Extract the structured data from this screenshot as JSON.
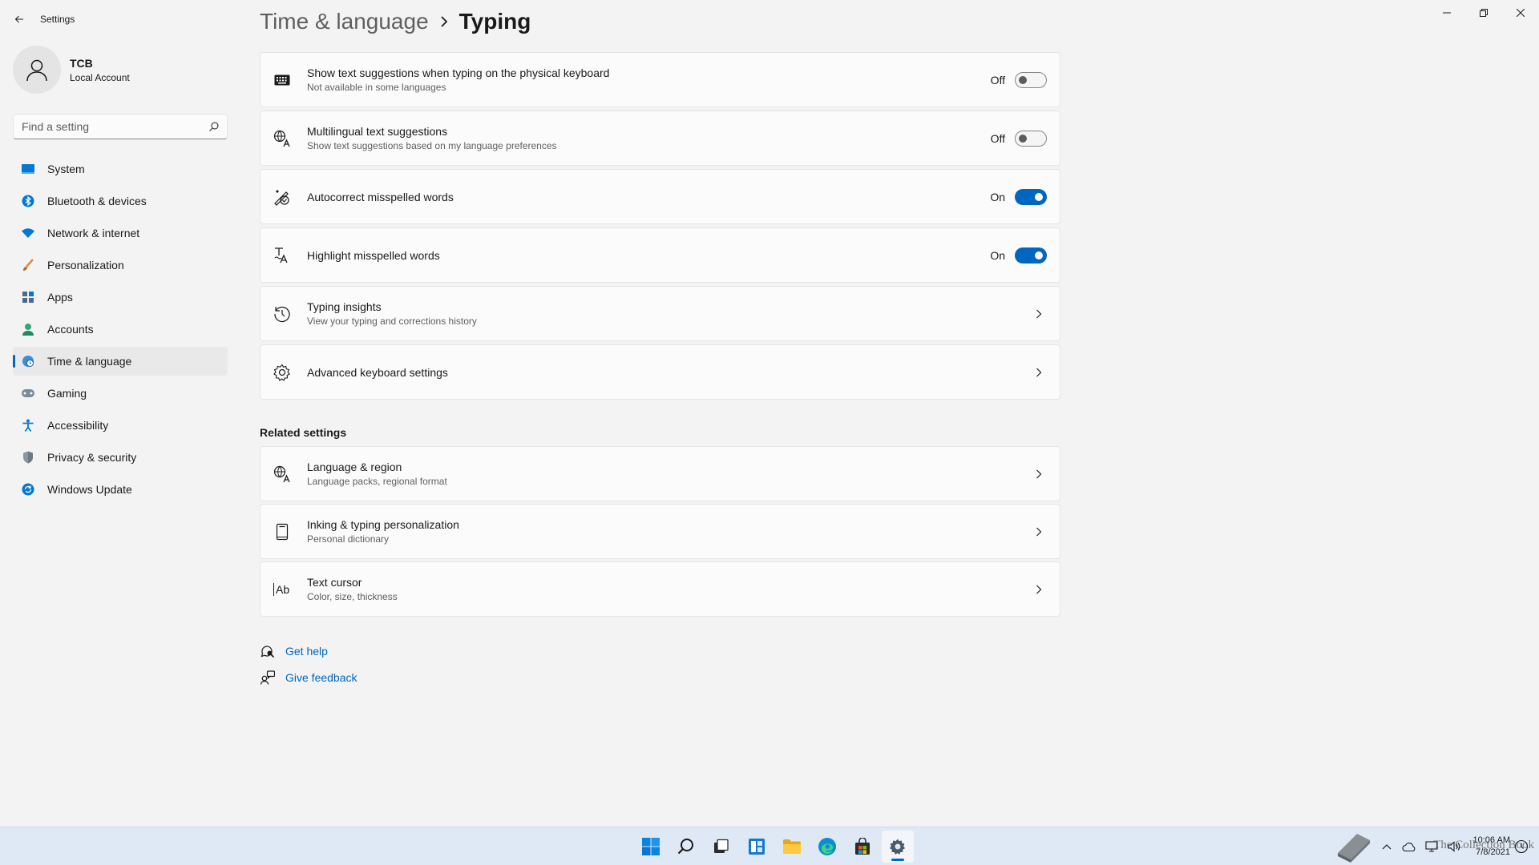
{
  "window": {
    "app_title": "Settings"
  },
  "profile": {
    "name": "TCB",
    "account_type": "Local Account"
  },
  "search": {
    "placeholder": "Find a setting"
  },
  "nav": {
    "items": [
      {
        "label": "System",
        "icon": "system-icon"
      },
      {
        "label": "Bluetooth & devices",
        "icon": "bluetooth-icon"
      },
      {
        "label": "Network & internet",
        "icon": "wifi-icon"
      },
      {
        "label": "Personalization",
        "icon": "brush-icon"
      },
      {
        "label": "Apps",
        "icon": "apps-icon"
      },
      {
        "label": "Accounts",
        "icon": "person-icon"
      },
      {
        "label": "Time & language",
        "icon": "globe-clock-icon",
        "active": true
      },
      {
        "label": "Gaming",
        "icon": "gamepad-icon"
      },
      {
        "label": "Accessibility",
        "icon": "accessibility-icon"
      },
      {
        "label": "Privacy & security",
        "icon": "shield-icon"
      },
      {
        "label": "Windows Update",
        "icon": "update-icon"
      }
    ]
  },
  "breadcrumb": {
    "parent": "Time & language",
    "current": "Typing"
  },
  "settings": [
    {
      "title": "Show text suggestions when typing on the physical keyboard",
      "subtitle": "Not available in some languages",
      "state": "Off",
      "icon": "keyboard-icon"
    },
    {
      "title": "Multilingual text suggestions",
      "subtitle": "Show text suggestions based on my language preferences",
      "state": "Off",
      "icon": "language-icon"
    },
    {
      "title": "Autocorrect misspelled words",
      "subtitle": "",
      "state": "On",
      "icon": "autocorrect-icon"
    },
    {
      "title": "Highlight misspelled words",
      "subtitle": "",
      "state": "On",
      "icon": "spellcheck-icon"
    },
    {
      "title": "Typing insights",
      "subtitle": "View your typing and corrections history",
      "icon": "history-icon"
    },
    {
      "title": "Advanced keyboard settings",
      "subtitle": "",
      "icon": "gear-icon"
    }
  ],
  "related": {
    "heading": "Related settings",
    "items": [
      {
        "title": "Language & region",
        "subtitle": "Language packs, regional format",
        "icon": "language-icon"
      },
      {
        "title": "Inking & typing personalization",
        "subtitle": "Personal dictionary",
        "icon": "notebook-icon"
      },
      {
        "title": "Text cursor",
        "subtitle": "Color, size, thickness",
        "icon": "text-cursor-icon"
      }
    ]
  },
  "help": {
    "get_help": "Get help",
    "give_feedback": "Give feedback"
  },
  "taskbar": {
    "time": "10:06 AM",
    "date": "7/8/2021",
    "watermark": "The Collection Book"
  },
  "icons": {
    "text_cursor_glyph": "Ab"
  },
  "colors": {
    "accent": "#0067c0",
    "background": "#f3f3f3",
    "card": "#fbfbfb"
  }
}
